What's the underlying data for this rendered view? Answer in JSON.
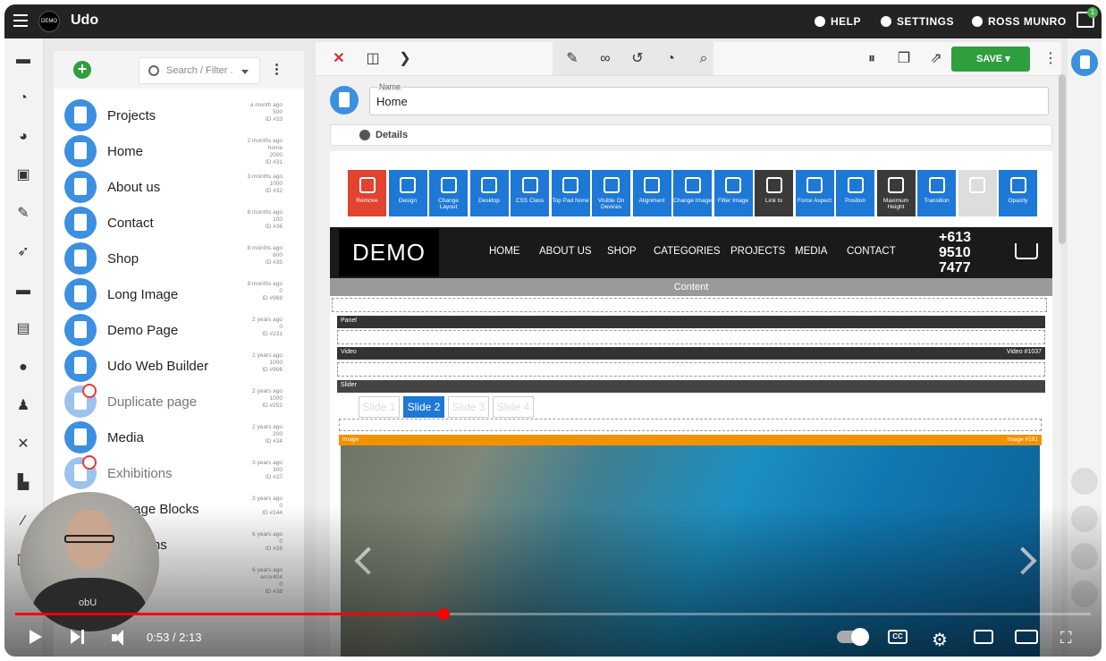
{
  "app": {
    "title": "Udo",
    "logo_text": "DEMO"
  },
  "topnav": {
    "help": "HELP",
    "settings": "SETTINGS",
    "user": "ROSS MUNRO",
    "notifications": "1"
  },
  "rail_icons": [
    "folder-icon",
    "dashboard-icon",
    "palette-icon",
    "gift-icon",
    "edit-icon",
    "rocket-icon",
    "card-icon",
    "gallery-icon",
    "chat-icon",
    "users-icon",
    "tools-icon",
    "cart-icon",
    "pencil-icon",
    "trash-icon"
  ],
  "list": {
    "search_placeholder": "Search / Filter .",
    "items": [
      {
        "name": "Projects",
        "time": "a month ago",
        "count": "500",
        "id": "ID #33",
        "dim": false
      },
      {
        "name": "Home",
        "time": "2 months ago",
        "count": "home",
        "count2": "2000",
        "id": "ID #31",
        "dim": false
      },
      {
        "name": "About us",
        "time": "3 months ago",
        "count": "1000",
        "id": "ID #32",
        "dim": false
      },
      {
        "name": "Contact",
        "time": "8 months ago",
        "count": "100",
        "id": "ID #36",
        "dim": false
      },
      {
        "name": "Shop",
        "time": "8 months ago",
        "count": "600",
        "id": "ID #35",
        "dim": false
      },
      {
        "name": "Long Image",
        "time": "9 months ago",
        "count": "0",
        "id": "ID #968",
        "dim": false
      },
      {
        "name": "Demo Page",
        "time": "2 years ago",
        "count": "0",
        "id": "ID #231",
        "dim": false
      },
      {
        "name": "Udo Web Builder",
        "time": "2 years ago",
        "count": "1000",
        "id": "ID #906",
        "dim": false
      },
      {
        "name": "Duplicate page",
        "time": "2 years ago",
        "count": "1000",
        "id": "ID #252",
        "dim": true
      },
      {
        "name": "Media",
        "time": "2 years ago",
        "count": "200",
        "id": "ID #34",
        "dim": false
      },
      {
        "name": "Exhibitions",
        "time": "3 years ago",
        "count": "300",
        "id": "ID #37",
        "dim": true
      },
      {
        "name": "mepage Blocks",
        "time": "3 years ago",
        "count": "0",
        "id": "ID #144",
        "dim": false
      },
      {
        "name": "& Returns",
        "time": "6 years ago",
        "count": "0",
        "id": "ID #39",
        "dim": false
      },
      {
        "name": "",
        "time": "6 years ago",
        "count": "error404",
        "count2": "0",
        "id": "ID #38",
        "dim": false
      }
    ]
  },
  "editor": {
    "save_label": "SAVE",
    "name_label": "Name",
    "name_value": "Home",
    "details_label": "Details",
    "tiles": [
      "Remove",
      "Design",
      "Change Layout",
      "Desktop",
      "CSS Class",
      "Top Pad None",
      "Visible On Devices",
      "Alignment",
      "Change Image",
      "Filter Image",
      "Link to",
      "Force Aspect",
      "Position",
      "Maximum Height",
      "Transition",
      "",
      "Opacity"
    ]
  },
  "site": {
    "logo": "DEMO",
    "nav": [
      "HOME",
      "ABOUT US",
      "SHOP",
      "CATEGORIES",
      "PROJECTS",
      "MEDIA",
      "CONTACT"
    ],
    "phone": [
      "+613",
      "9510",
      "7477"
    ],
    "content_label": "Content",
    "panel_label": "Panel",
    "video_label": "Video",
    "video_id": "Video #1037",
    "slider_label": "Slider",
    "slides": [
      "Slide 1",
      "Slide 2",
      "Slide 3",
      "Slide 4"
    ],
    "active_slide": 1,
    "image_label": "Image",
    "image_id": "Image #191"
  },
  "video": {
    "current": "0:53",
    "duration": "2:13",
    "time_text": "0:53 / 2:13",
    "progress": 0.398,
    "webcam_shirt": "obU",
    "cc_label": "CC"
  },
  "colors": {
    "accent_blue": "#1e78d6",
    "save_green": "#2e9e3e",
    "remove_red": "#e24230",
    "progress_red": "#ff0000"
  }
}
